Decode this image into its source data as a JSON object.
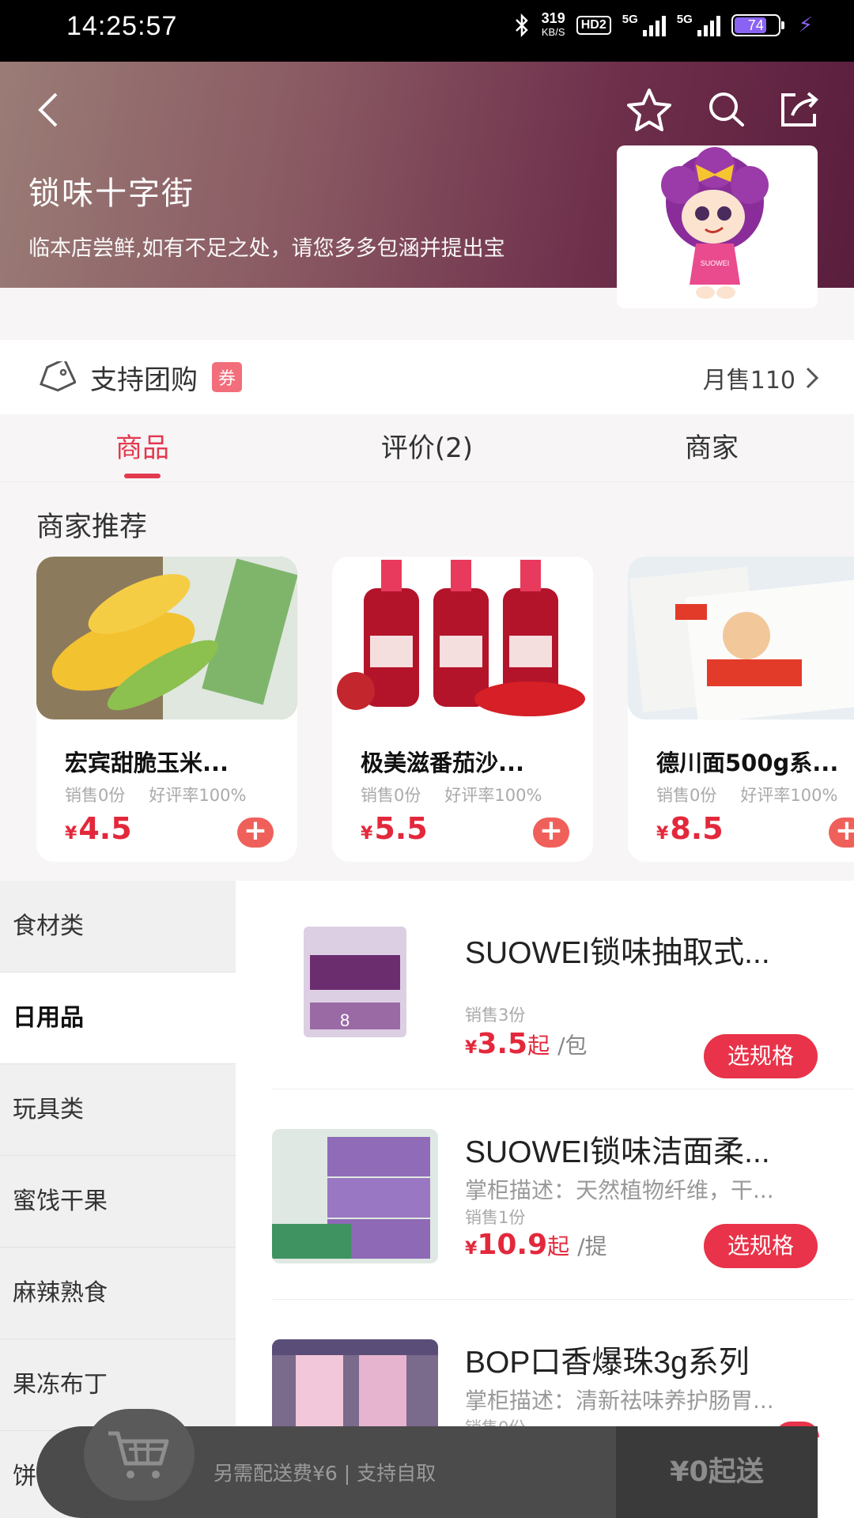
{
  "status_bar": {
    "time": "14:25:57",
    "net_speed": "319",
    "net_unit": "KB/S",
    "hd": "HD2",
    "sig1": "5G",
    "sig2": "5G",
    "battery": "74",
    "battery_level": 0.74
  },
  "header": {
    "shop_name": "锁味十字街",
    "notice": "临本店尝鲜,如有不足之处，请您多多包涵并提出宝",
    "logo_text": "SUOWEI"
  },
  "group_buy": {
    "label": "支持团购",
    "coupon": "券",
    "monthly_sales": "月售110"
  },
  "tabs": [
    {
      "label": "商品"
    },
    {
      "label": "评价(2)"
    },
    {
      "label": "商家"
    }
  ],
  "recommend": {
    "title": "商家推荐",
    "items": [
      {
        "name": "宏宾甜脆玉米...",
        "sales": "销售0份",
        "rating": "好评率100%",
        "currency": "¥",
        "price": "4.5"
      },
      {
        "name": "极美滋番茄沙...",
        "sales": "销售0份",
        "rating": "好评率100%",
        "currency": "¥",
        "price": "5.5"
      },
      {
        "name": "德川面500g系...",
        "sales": "销售0份",
        "rating": "好评率100%",
        "currency": "¥",
        "price": "8.5"
      }
    ]
  },
  "categories": [
    {
      "label": "食材类"
    },
    {
      "label": "日用品"
    },
    {
      "label": "玩具类"
    },
    {
      "label": "蜜饯干果"
    },
    {
      "label": "麻辣熟食"
    },
    {
      "label": "果冻布丁"
    },
    {
      "label": "饼"
    }
  ],
  "products": [
    {
      "name": "SUOWEI锁味抽取式...",
      "desc": "",
      "sales": "销售3份",
      "currency": "¥",
      "price": "3.5",
      "qi": "起",
      "unit": "/包",
      "button": "选规格"
    },
    {
      "name": "SUOWEI锁味洁面柔...",
      "desc": "掌柜描述：天然植物纤维，干...",
      "sales": "销售1份",
      "currency": "¥",
      "price": "10.9",
      "qi": "起",
      "unit": "/提",
      "button": "选规格"
    },
    {
      "name": "BOP口香爆珠3g系列",
      "desc": "掌柜描述：清新祛味养护肠胃...",
      "sales": "销售0份"
    }
  ],
  "cart": {
    "delivery": "另需配送费¥6 | 支持自取",
    "min_order": "¥0起送"
  },
  "colors": {
    "accent": "#e3394f",
    "price": "#e3283b",
    "header_start": "#9a7c76",
    "header_end": "#5a1e3d"
  }
}
